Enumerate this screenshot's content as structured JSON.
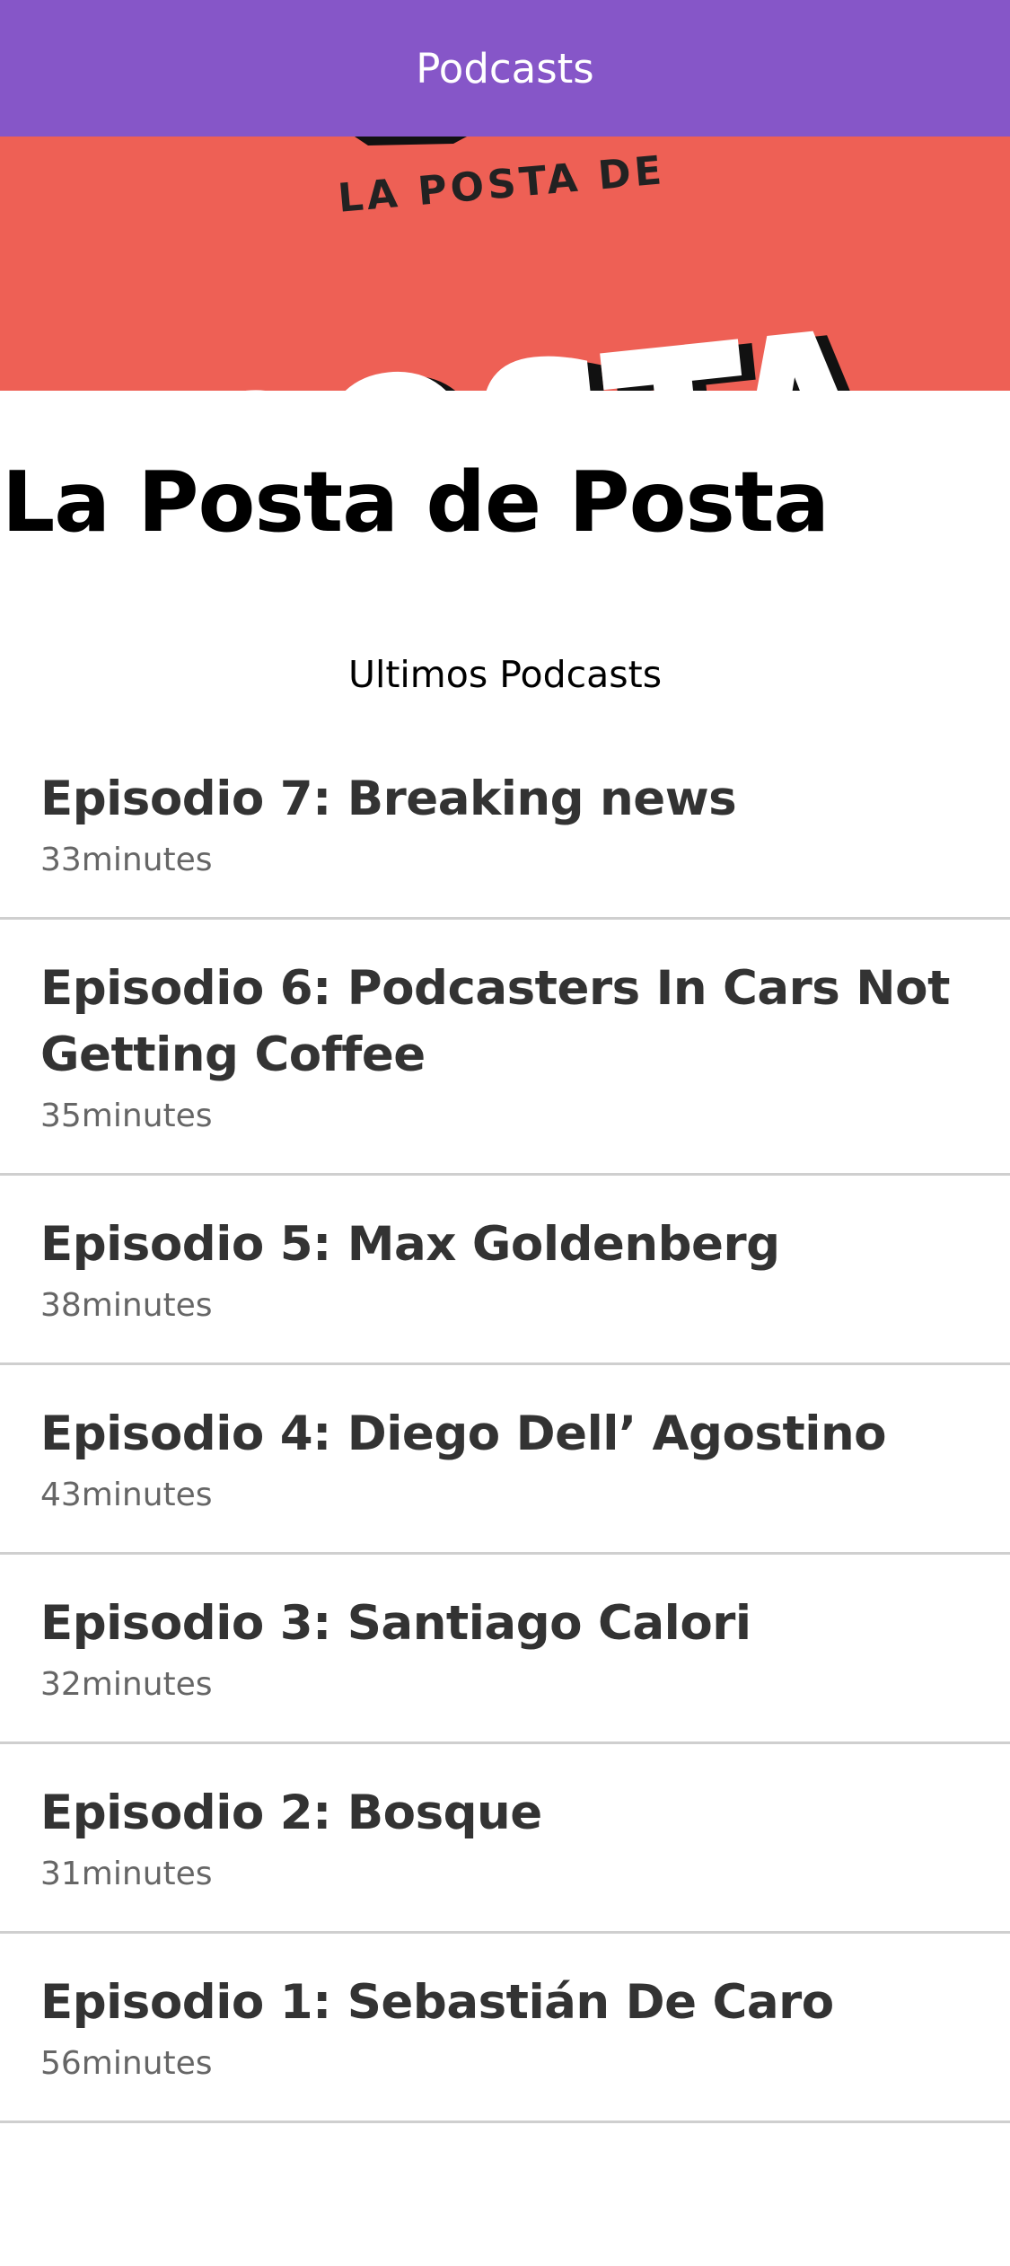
{
  "app_bar": {
    "title": "Podcasts",
    "background": "#8656c8"
  },
  "banner": {
    "background": "#ee6055",
    "logo_small_text": "LA POSTA DE",
    "logo_big_text": "POSTA"
  },
  "show": {
    "title": "La Posta de Posta"
  },
  "section": {
    "heading": "Ultimos Podcasts"
  },
  "episodes": [
    {
      "title": "Episodio 7: Breaking news",
      "duration": "33minutes"
    },
    {
      "title": "Episodio 6: Podcasters In Cars Not Getting Coffee",
      "duration": "35minutes"
    },
    {
      "title": "Episodio 5: Max Goldenberg",
      "duration": "38minutes"
    },
    {
      "title": "Episodio 4: Diego Dell’ Agostino",
      "duration": "43minutes"
    },
    {
      "title": "Episodio 3: Santiago Calori",
      "duration": "32minutes"
    },
    {
      "title": "Episodio 2: Bosque",
      "duration": "31minutes"
    },
    {
      "title": "Episodio 1: Sebastián De Caro",
      "duration": "56minutes"
    }
  ]
}
